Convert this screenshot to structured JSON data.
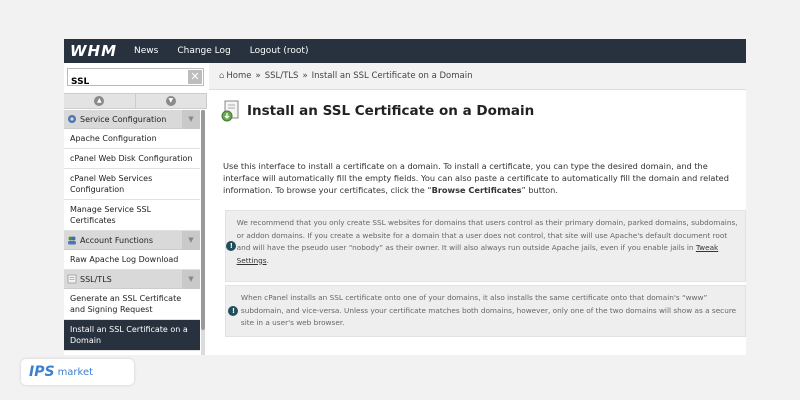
{
  "topbar": {
    "logo": "WHM",
    "links": [
      "News",
      "Change Log",
      "Logout (root)"
    ]
  },
  "sidebar": {
    "search_value": "SSL",
    "clear_label": "✕",
    "categories": [
      {
        "label": "Service Configuration",
        "items": [
          "Apache Configuration",
          "cPanel Web Disk Configuration",
          "cPanel Web Services Configuration",
          "Manage Service SSL Certificates"
        ]
      },
      {
        "label": "Account Functions",
        "items": [
          "Raw Apache Log Download"
        ]
      },
      {
        "label": "SSL/TLS",
        "items": [
          "Generate an SSL Certificate and Signing Request",
          "Install an SSL Certificate on a Domain"
        ]
      }
    ]
  },
  "breadcrumb": {
    "home": "Home",
    "section": "SSL/TLS",
    "current": "Install an SSL Certificate on a Domain",
    "separator": "»"
  },
  "page": {
    "title": "Install an SSL Certificate on a Domain",
    "intro_prefix": "Use this interface to install a certificate on a domain. To install a certificate, you can type the desired domain, and the interface will automatically fill the empty fields. You can also paste a certificate to automatically fill the domain and related information. To browse your certificates, click the “",
    "intro_bold": "Browse Certificates",
    "intro_suffix": "” button.",
    "alert1_text": "We recommend that you only create SSL websites for domains that users control as their primary domain, parked domains, subdomains, or addon domains. If you create a website for a domain that a user does not control, that site will use Apache's default document root and will have the pseudo user “nobody” as their owner. It will also always run outside Apache jails, even if you enable jails in ",
    "alert1_link": "Tweak Settings",
    "alert1_end": ".",
    "alert2_text": "When cPanel installs an SSL certificate onto one of your domains, it also installs the same certificate onto that domain's “www” subdomain, and vice-versa. Unless your certificate matches both domains, however, only one of the two domains will show as a secure site in a user's web browser."
  },
  "badge": {
    "mark": "IPS",
    "text": "market"
  },
  "colors": {
    "topbar": "#28323e",
    "active_item": "#28323e",
    "alert_icon": "#1f4f5a",
    "badge": "#3b7fd1"
  }
}
